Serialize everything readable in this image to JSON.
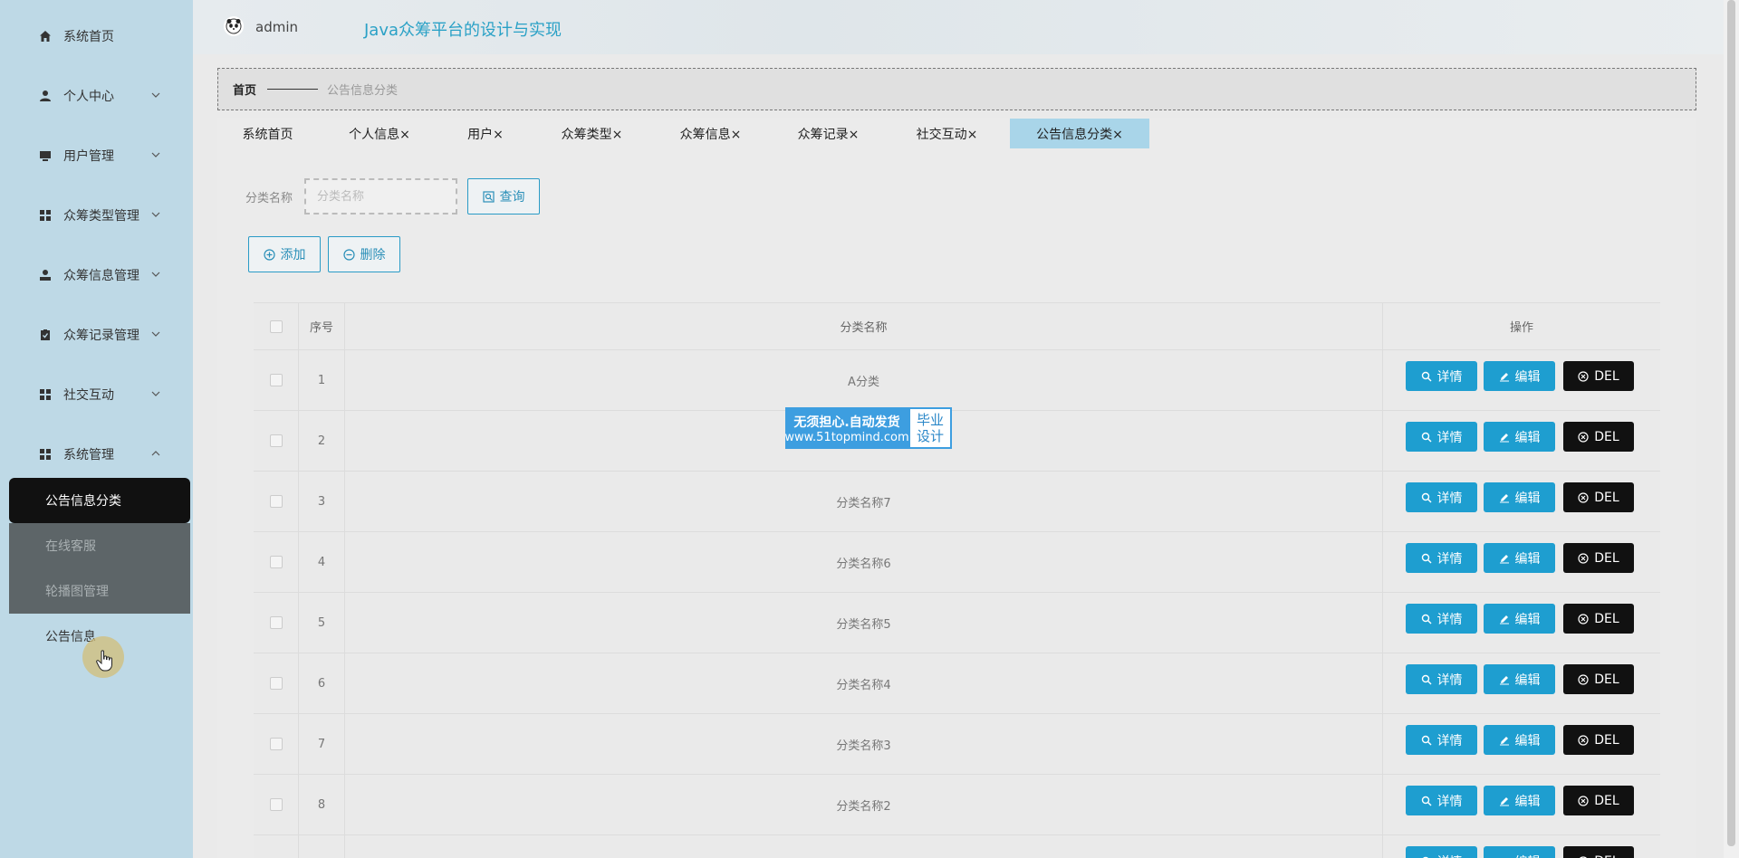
{
  "app": {
    "title": "Java众筹平台的设计与实现",
    "username": "admin",
    "avatar_icon": "panda-avatar-icon"
  },
  "sidebar": {
    "items": [
      {
        "label": "系统首页",
        "icon": "home-icon"
      },
      {
        "label": "个人中心",
        "icon": "user-icon"
      },
      {
        "label": "用户管理",
        "icon": "monitor-icon"
      },
      {
        "label": "众筹类型管理",
        "icon": "grid-icon"
      },
      {
        "label": "众筹信息管理",
        "icon": "person-icon"
      },
      {
        "label": "众筹记录管理",
        "icon": "clipboard-icon"
      },
      {
        "label": "社交互动",
        "icon": "grid-icon"
      },
      {
        "label": "系统管理",
        "icon": "grid-icon"
      }
    ],
    "submenu": [
      {
        "label": "公告信息分类"
      },
      {
        "label": "在线客服"
      },
      {
        "label": "轮播图管理"
      },
      {
        "label": "公告信息"
      }
    ]
  },
  "breadcrumb": {
    "home": "首页",
    "current": "公告信息分类"
  },
  "tabs": [
    {
      "label": "系统首页"
    },
    {
      "label": "个人信息×"
    },
    {
      "label": "用户×"
    },
    {
      "label": "众筹类型×"
    },
    {
      "label": "众筹信息×"
    },
    {
      "label": "众筹记录×"
    },
    {
      "label": "社交互动×"
    },
    {
      "label": "公告信息分类×"
    }
  ],
  "search": {
    "label": "分类名称",
    "placeholder": "分类名称",
    "query_label": "查询"
  },
  "actions": {
    "add_label": "添加",
    "delete_label": "删除"
  },
  "table": {
    "headers": {
      "index": "序号",
      "name": "分类名称",
      "ops": "操作"
    },
    "rows": [
      {
        "index": "1",
        "name": "A分类"
      },
      {
        "index": "2",
        "name": ""
      },
      {
        "index": "3",
        "name": "分类名称7"
      },
      {
        "index": "4",
        "name": "分类名称6"
      },
      {
        "index": "5",
        "name": "分类名称5"
      },
      {
        "index": "6",
        "name": "分类名称4"
      },
      {
        "index": "7",
        "name": "分类名称3"
      },
      {
        "index": "8",
        "name": "分类名称2"
      }
    ],
    "op_labels": {
      "detail": "详情",
      "edit": "编辑",
      "del": "DEL"
    }
  },
  "watermark": {
    "line1": "无须担心.自动发货",
    "line2": "www.51topmind.com",
    "badge1": "毕业",
    "badge2": "设计"
  },
  "colors": {
    "sidebar_bg": "#bed9e6",
    "accent": "#1e9ed0",
    "title": "#2aa1c6",
    "active_tab": "#a9d5e9",
    "del_button": "#111111"
  }
}
